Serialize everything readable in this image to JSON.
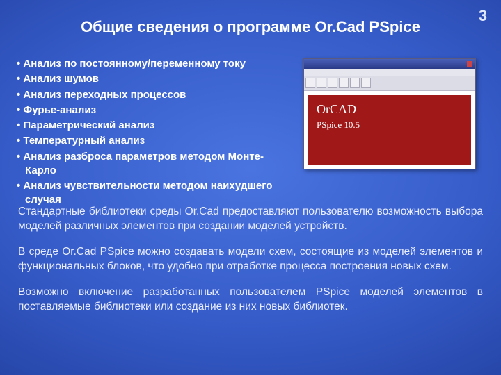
{
  "page_number": "3",
  "title": "Общие сведения о программе Or.Cad PSpice",
  "bullets": [
    "Анализ по постоянному/переменному току",
    "Анализ шумов",
    "Анализ переходных процессов",
    "Фурье-анализ",
    "Параметрический анализ",
    "Температурный анализ",
    "Анализ разброса параметров методом Монте-Карло",
    "Анализ чувствительности методом наихудшего случая"
  ],
  "screenshot": {
    "brand": "OrCAD",
    "version": "PSpice 10.5"
  },
  "paragraphs": [
    "Стандартные библиотеки среды Or.Cad предоставляют пользователю возможность выбора моделей различных элементов при создании моделей устройств.",
    "В среде Or.Cad PSpice можно создавать модели схем, состоящие из моделей элементов и функциональных блоков, что удобно при отработке процесса построения новых схем.",
    "Возможно включение разработанных пользователем PSpice моделей элементов в поставляемые библиотеки или создание из них новых библиотек."
  ]
}
